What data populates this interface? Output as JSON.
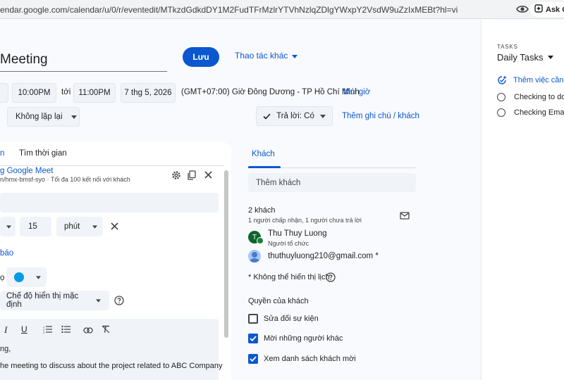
{
  "browser": {
    "url": "endar.google.com/calendar/u/0/r/eventedit/MTkzdGdkdDY1M2FudTFrMzlrYTVhNzlqZDlgYWxpY2VsdW9uZzIxMEBt?hl=vi",
    "ask_label": "Ask Go"
  },
  "event": {
    "title": "Meeting",
    "save_label": "Lưu",
    "more_actions_label": "Thao tác khác",
    "start_time": "10:00PM",
    "to_label": "tới",
    "end_time": "11:00PM",
    "date": "7 thg 5, 2026",
    "timezone": "(GMT+07:00) Giờ Đông Dương - TP Hồ Chí Minh",
    "timezone_link": "Múi giờ",
    "repeat": "Không lặp lại",
    "rsvp": "Trả lời: Có",
    "add_note": "Thêm ghi chú / khách"
  },
  "details": {
    "tab_partial": "n",
    "find_time": "Tìm thời gian",
    "meet_label": "g Google Meet",
    "meet_sub": "n/hmx-bmsf-syo · Tối đa 100 kết nối với khách",
    "notif_value": "15",
    "notif_unit": "phút",
    "add_notif": "báo",
    "visibility": "Chế độ hiển thị mặc định",
    "color": "#039be5",
    "desc_line1": "ng,",
    "desc_line2": "he meeting to discuss about the project related to ABC Company"
  },
  "guests": {
    "tab": "Khách",
    "add_placeholder": "Thêm khách",
    "count": "2 khách",
    "summary": "1 người chấp nhận, 1 người chưa trả lời",
    "list": [
      {
        "name": "Thu Thuy Luong",
        "role": "Người tổ chức",
        "initial": "T"
      },
      {
        "name": "thuthuyluong210@gmail.com *",
        "role": "",
        "initial": ""
      }
    ],
    "note": "* Không thể hiển thị lịch",
    "perm_title": "Quyền của khách",
    "perms": [
      {
        "label": "Sửa đổi sự kiện",
        "checked": false
      },
      {
        "label": "Mời những người khác",
        "checked": true
      },
      {
        "label": "Xem danh sách khách mời",
        "checked": true
      }
    ]
  },
  "tasks": {
    "header": "TASKS",
    "list_name": "Daily Tasks",
    "add_task": "Thêm việc cần l",
    "items": [
      "Checking to do",
      "Checking Emails"
    ]
  },
  "colors": {
    "accent": "#0b57d0",
    "avatar": "#0d652d"
  }
}
